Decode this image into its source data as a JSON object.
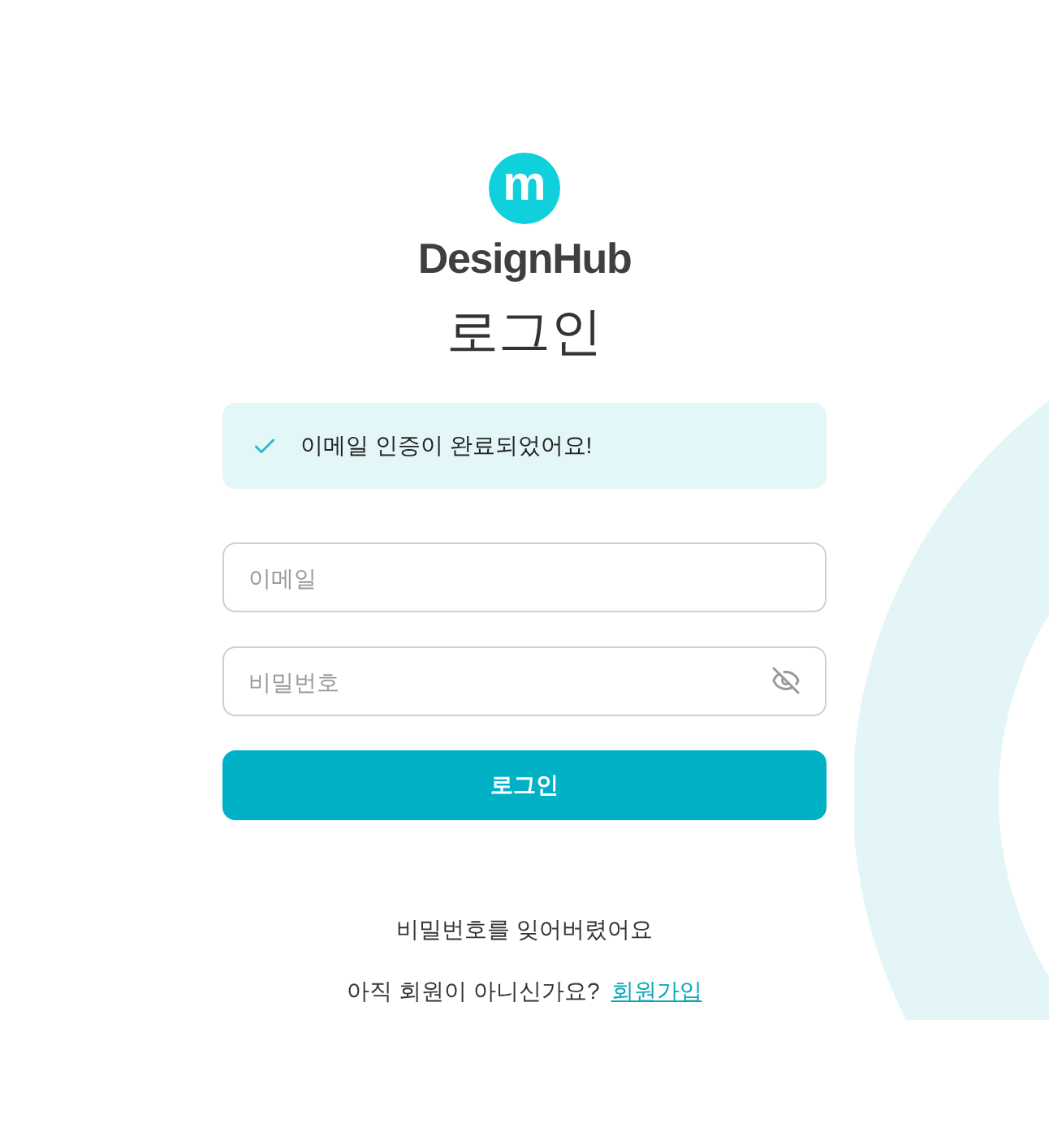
{
  "logo": {
    "mark": "m",
    "name": "DesignHub"
  },
  "title": "로그인",
  "alert": {
    "message": "이메일 인증이 완료되었어요!"
  },
  "email_field": {
    "placeholder": "이메일"
  },
  "password_field": {
    "placeholder": "비밀번호",
    "password_visible": false
  },
  "login_button": "로그인",
  "forgot_password_link": "비밀번호를 잊어버렸어요",
  "signup_prompt": {
    "text": "아직 회원이 아니신가요?",
    "link": "회원가입"
  }
}
